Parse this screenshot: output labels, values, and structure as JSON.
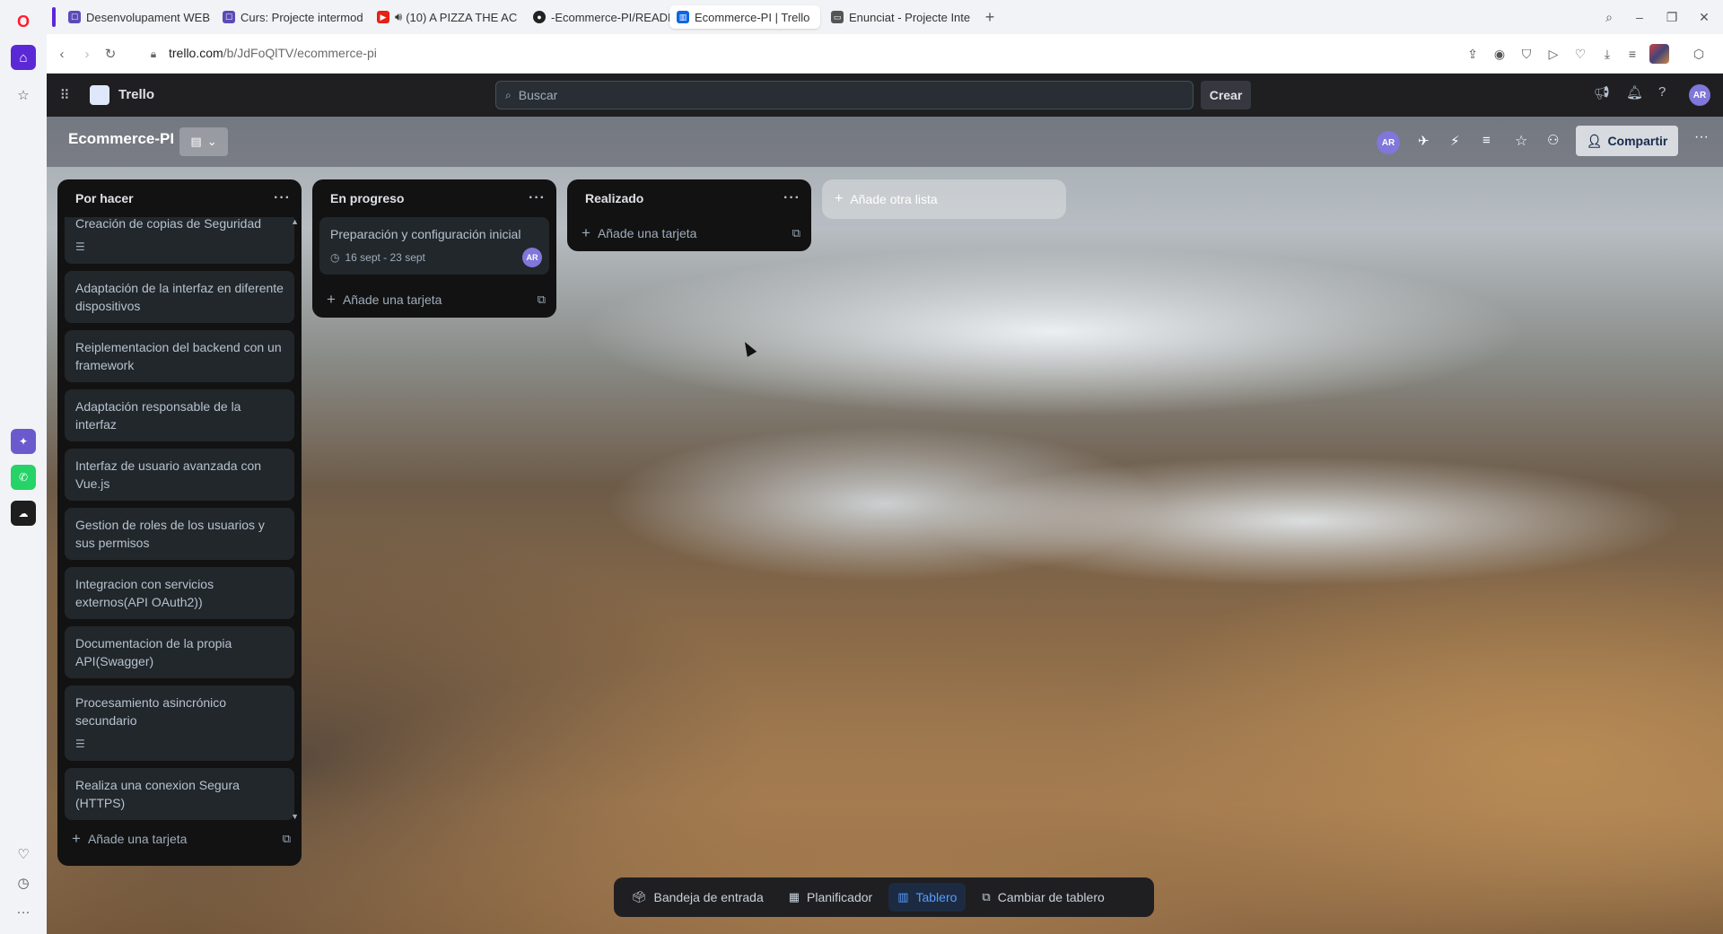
{
  "browser": {
    "tabs": [
      {
        "title": "Desenvolupament WEB",
        "favicon_color": "#5b4bb7"
      },
      {
        "title": "Curs: Projecte intermod",
        "favicon_color": "#5b4bb7"
      },
      {
        "title": "(10) A PIZZA THE AC",
        "favicon_color": "#e62117"
      },
      {
        "title": "-Ecommerce-PI/READM",
        "favicon_color": "#222222"
      },
      {
        "title": "Ecommerce-PI | Trello",
        "favicon_color": "#0c66e4"
      },
      {
        "title": "Enunciat - Projecte Inte",
        "favicon_color": "#555555"
      }
    ],
    "new_tab_label": "+",
    "url_host": "trello.com",
    "url_path": "/b/JdFoQlTV/ecommerce-pi"
  },
  "trello": {
    "brand": "Trello",
    "search_placeholder": "Buscar",
    "create_label": "Crear",
    "user_initials": "AR",
    "board_title": "Ecommerce-PI",
    "share_label": "Compartir",
    "lists": [
      {
        "title": "Por hacer",
        "cards": [
          {
            "text": "Creación de copias de Seguridad",
            "has_description": true
          },
          {
            "text": "Adaptación de la interfaz en diferente dispositivos",
            "has_description": false
          },
          {
            "text": "Reiplementacion del backend con un framework",
            "has_description": false
          },
          {
            "text": "Adaptación responsable de la interfaz",
            "has_description": false
          },
          {
            "text": "Interfaz de usuario avanzada con Vue.js",
            "has_description": false
          },
          {
            "text": "Gestion de roles de los usuarios y sus permisos",
            "has_description": false
          },
          {
            "text": "Integracion con servicios externos(API OAuth2))",
            "has_description": false
          },
          {
            "text": "Documentacion de la propia API(Swagger)",
            "has_description": false
          },
          {
            "text": "Procesamiento asincrónico secundario",
            "has_description": true
          },
          {
            "text": "Realiza una conexion Segura (HTTPS)",
            "has_description": false
          }
        ],
        "add_card_label": "Añade una tarjeta"
      },
      {
        "title": "En progreso",
        "cards": [
          {
            "text": "Preparación y configuración inicial",
            "dates": "16 sept - 23 sept",
            "member": "AR"
          }
        ],
        "add_card_label": "Añade una tarjeta"
      },
      {
        "title": "Realizado",
        "cards": [],
        "add_card_label": "Añade una tarjeta"
      }
    ],
    "add_list_label": "Añade otra lista",
    "bottom_nav": [
      {
        "label": "Bandeja de entrada",
        "icon": "inbox-icon",
        "active": false
      },
      {
        "label": "Planificador",
        "icon": "calendar-icon",
        "active": false
      },
      {
        "label": "Tablero",
        "icon": "board-icon",
        "active": true
      },
      {
        "label": "Cambiar de tablero",
        "icon": "switch-board-icon",
        "active": false
      }
    ]
  }
}
